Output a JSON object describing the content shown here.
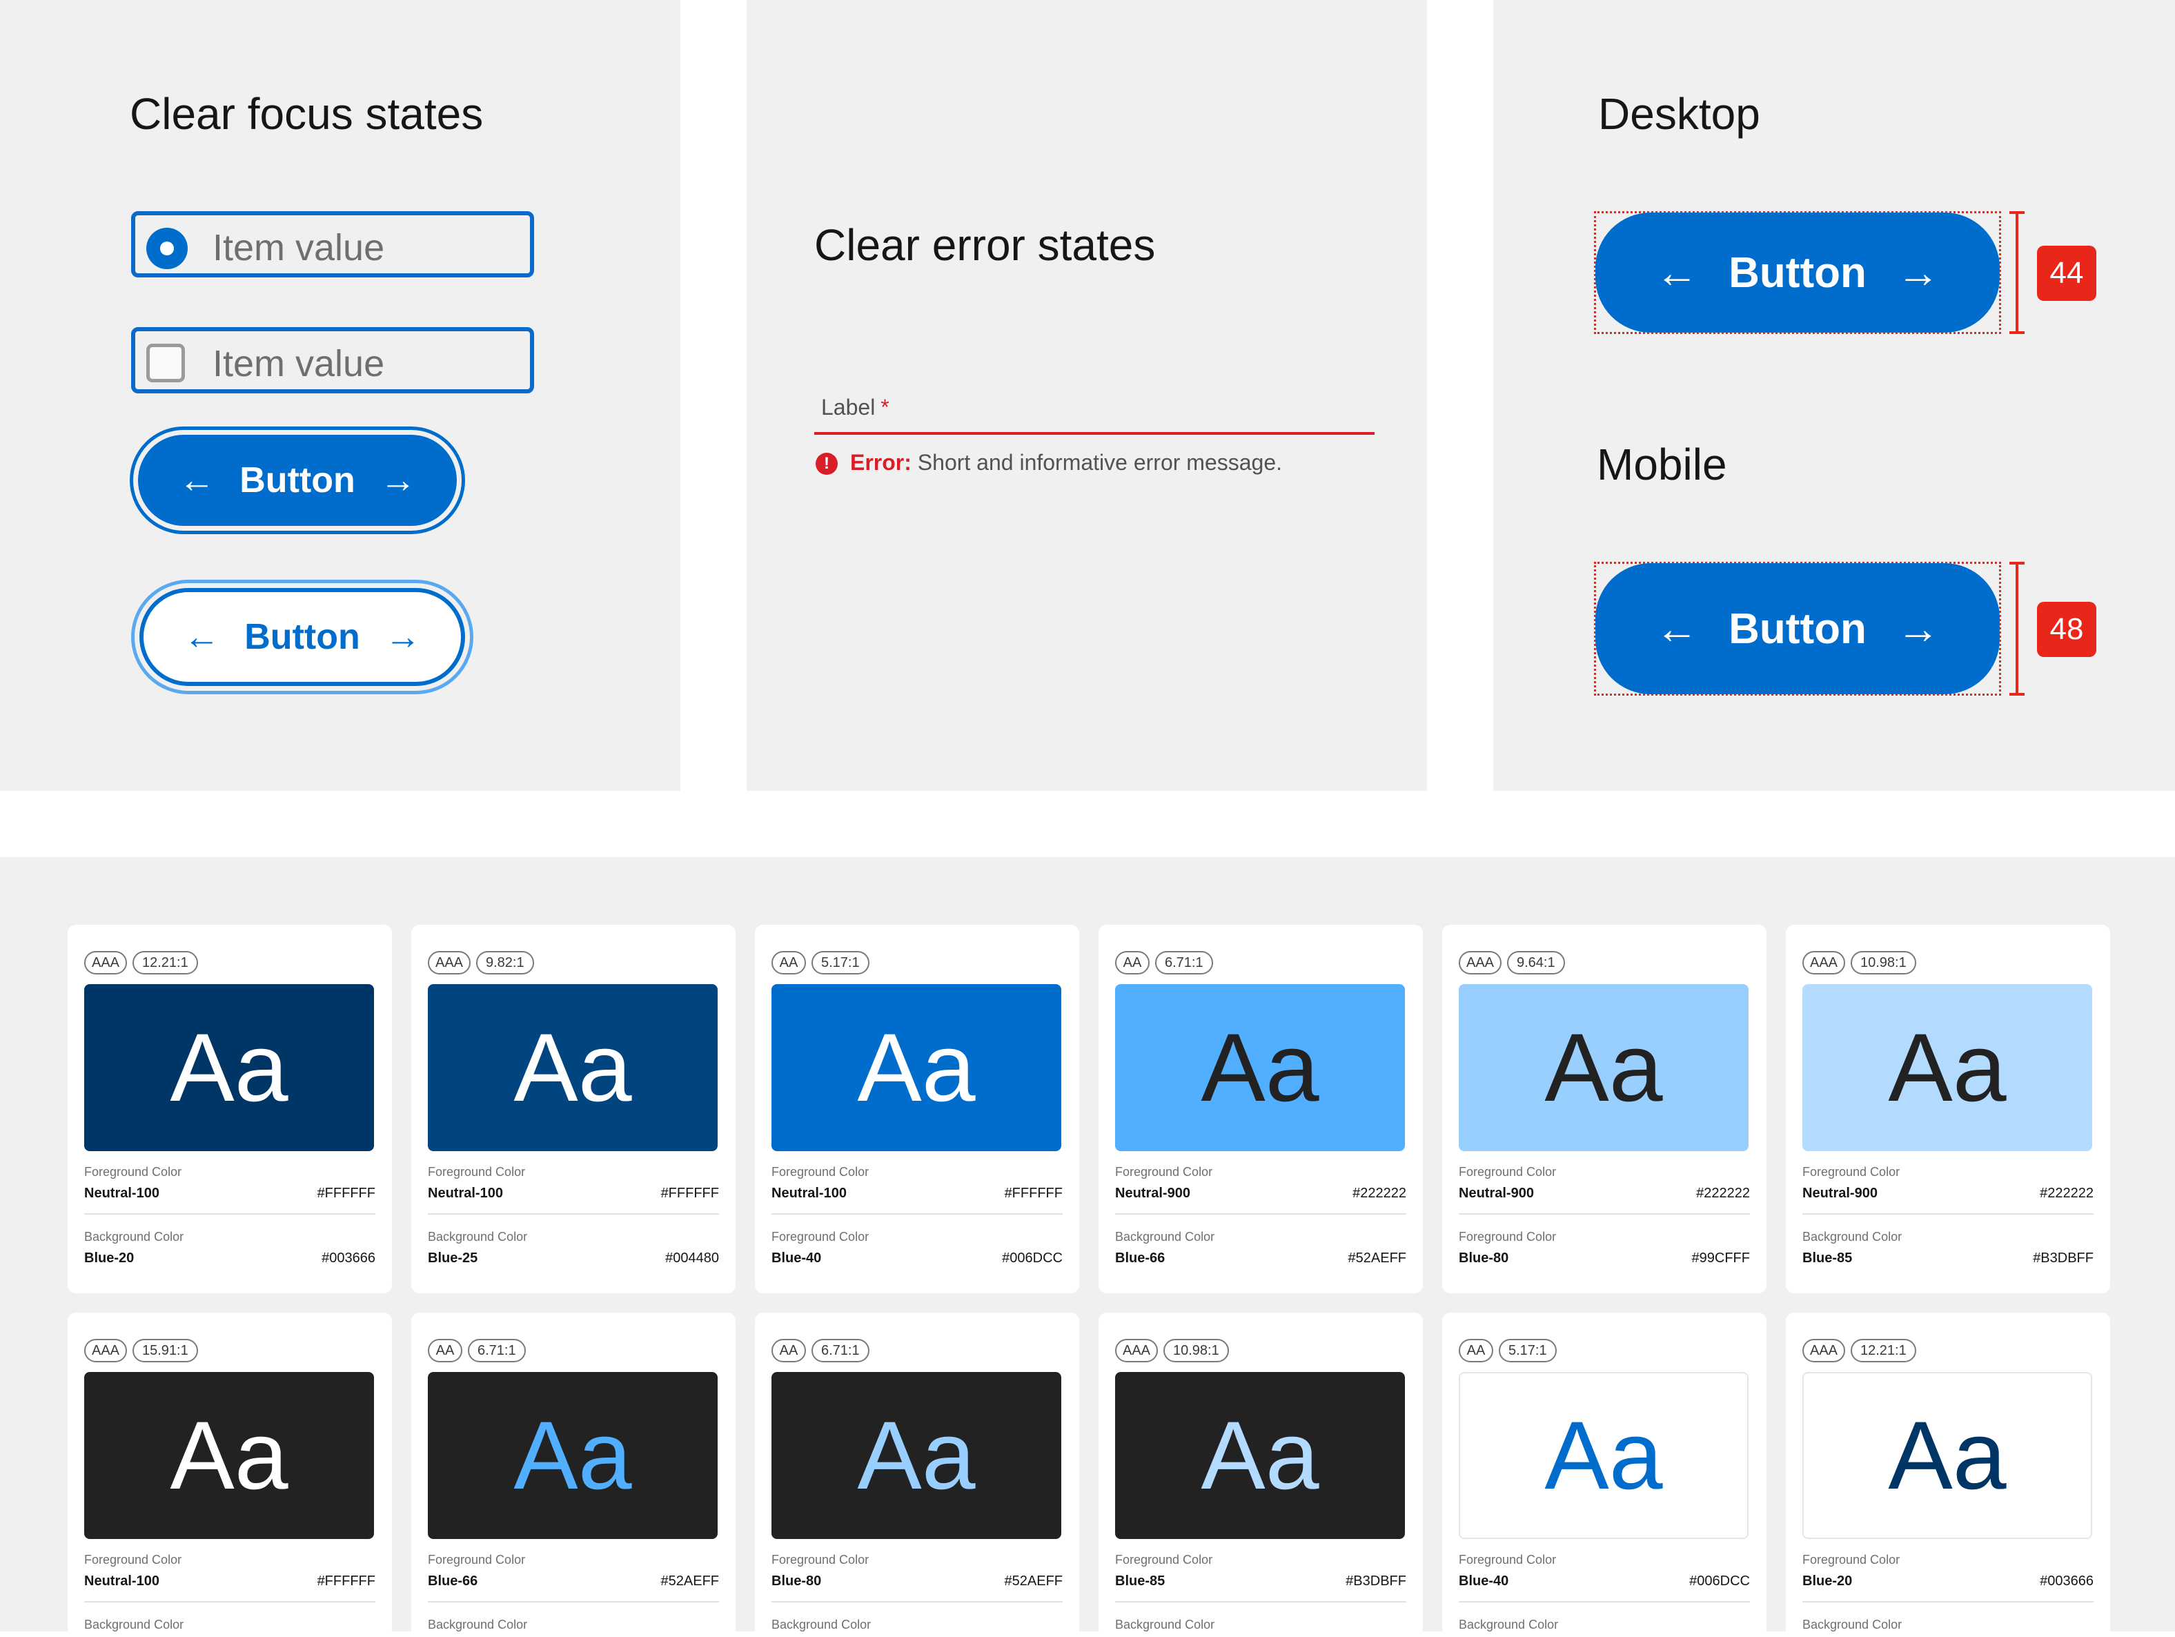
{
  "focus_panel": {
    "title": "Clear focus states",
    "radio_item": "Item value",
    "checkbox_item": "Item value",
    "button_solid": "Button",
    "button_outline": "Button"
  },
  "error_panel": {
    "title": "Clear error states",
    "label": "Label",
    "required_mark": "*",
    "error_prefix": "Error:",
    "error_message": "Short and informative error message."
  },
  "target_panel": {
    "desktop_title": "Desktop",
    "desktop_button": "Button",
    "desktop_size": "44",
    "mobile_title": "Mobile",
    "mobile_button": "Button",
    "mobile_size": "48"
  },
  "icons": {
    "arrow_left": "←",
    "arrow_right": "→",
    "error": "!"
  },
  "colors": {
    "primary": "#006DCC",
    "error": "#DA1E28",
    "measure": "#E8271A",
    "panel_bg": "#F0F0F0"
  },
  "swatches": [
    {
      "level": "AAA",
      "ratio": "12.21:1",
      "sample": "Aa",
      "fg_label": "Foreground Color",
      "fg_name": "Neutral-100",
      "fg_hex": "#FFFFFF",
      "bg_label": "Background Color",
      "bg_name": "Blue-20",
      "bg_hex": "#003666",
      "fg": "#FFFFFF",
      "bg": "#003666"
    },
    {
      "level": "AAA",
      "ratio": "9.82:1",
      "sample": "Aa",
      "fg_label": "Foreground Color",
      "fg_name": "Neutral-100",
      "fg_hex": "#FFFFFF",
      "bg_label": "Background Color",
      "bg_name": "Blue-25",
      "bg_hex": "#004480",
      "fg": "#FFFFFF",
      "bg": "#004480"
    },
    {
      "level": "AA",
      "ratio": "5.17:1",
      "sample": "Aa",
      "fg_label": "Foreground Color",
      "fg_name": "Neutral-100",
      "fg_hex": "#FFFFFF",
      "bg_label": "Foreground Color",
      "bg_name": "Blue-40",
      "bg_hex": "#006DCC",
      "fg": "#FFFFFF",
      "bg": "#006DCC"
    },
    {
      "level": "AA",
      "ratio": "6.71:1",
      "sample": "Aa",
      "fg_label": "Foreground Color",
      "fg_name": "Neutral-900",
      "fg_hex": "#222222",
      "bg_label": "Background Color",
      "bg_name": "Blue-66",
      "bg_hex": "#52AEFF",
      "fg": "#222222",
      "bg": "#52AEFF"
    },
    {
      "level": "AAA",
      "ratio": "9.64:1",
      "sample": "Aa",
      "fg_label": "Foreground Color",
      "fg_name": "Neutral-900",
      "fg_hex": "#222222",
      "bg_label": "Foreground Color",
      "bg_name": "Blue-80",
      "bg_hex": "#99CFFF",
      "fg": "#222222",
      "bg": "#99CFFF"
    },
    {
      "level": "AAA",
      "ratio": "10.98:1",
      "sample": "Aa",
      "fg_label": "Foreground Color",
      "fg_name": "Neutral-900",
      "fg_hex": "#222222",
      "bg_label": "Background Color",
      "bg_name": "Blue-85",
      "bg_hex": "#B3DBFF",
      "fg": "#222222",
      "bg": "#B3DBFF"
    },
    {
      "level": "AAA",
      "ratio": "15.91:1",
      "sample": "Aa",
      "fg_label": "Foreground Color",
      "fg_name": "Neutral-100",
      "fg_hex": "#FFFFFF",
      "bg_label": "Background Color",
      "fg": "#FFFFFF",
      "bg": "#222222"
    },
    {
      "level": "AA",
      "ratio": "6.71:1",
      "sample": "Aa",
      "fg_label": "Foreground Color",
      "fg_name": "Blue-66",
      "fg_hex": "#52AEFF",
      "bg_label": "Background Color",
      "fg": "#52AEFF",
      "bg": "#222222"
    },
    {
      "level": "AA",
      "ratio": "6.71:1",
      "sample": "Aa",
      "fg_label": "Foreground Color",
      "fg_name": "Blue-80",
      "fg_hex": "#52AEFF",
      "bg_label": "Background Color",
      "fg": "#99CFFF",
      "bg": "#222222"
    },
    {
      "level": "AAA",
      "ratio": "10.98:1",
      "sample": "Aa",
      "fg_label": "Foreground Color",
      "fg_name": "Blue-85",
      "fg_hex": "#B3DBFF",
      "bg_label": "Background Color",
      "fg": "#B3DBFF",
      "bg": "#222222"
    },
    {
      "level": "AA",
      "ratio": "5.17:1",
      "sample": "Aa",
      "fg_label": "Foreground Color",
      "fg_name": "Blue-40",
      "fg_hex": "#006DCC",
      "bg_label": "Background Color",
      "fg": "#006DCC",
      "bg": "#FFFFFF"
    },
    {
      "level": "AAA",
      "ratio": "12.21:1",
      "sample": "Aa",
      "fg_label": "Foreground Color",
      "fg_name": "Blue-20",
      "fg_hex": "#003666",
      "bg_label": "Background Color",
      "fg": "#003666",
      "bg": "#FFFFFF"
    }
  ]
}
